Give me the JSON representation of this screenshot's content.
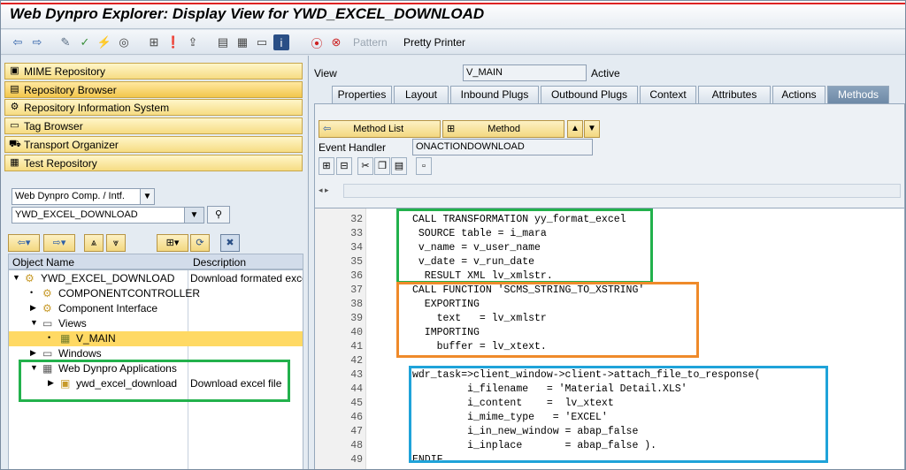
{
  "window": {
    "title": "Web Dynpro Explorer: Display View for YWD_EXCEL_DOWNLOAD"
  },
  "toolbar": {
    "pattern_label": "Pattern",
    "pretty_printer_label": "Pretty Printer"
  },
  "left_nav": {
    "items": [
      {
        "label": "MIME Repository",
        "icon": "mime-icon"
      },
      {
        "label": "Repository Browser",
        "icon": "browser-icon"
      },
      {
        "label": "Repository Information System",
        "icon": "info-system-icon"
      },
      {
        "label": "Tag Browser",
        "icon": "tag-icon"
      },
      {
        "label": "Transport Organizer",
        "icon": "truck-icon"
      },
      {
        "label": "Test Repository",
        "icon": "test-icon"
      }
    ],
    "object_type": "Web Dynpro Comp. / Intf.",
    "object_name": "YWD_EXCEL_DOWNLOAD"
  },
  "tree": {
    "col_object": "Object Name",
    "col_desc": "Description",
    "rows": [
      {
        "name": "YWD_EXCEL_DOWNLOAD",
        "desc": "Download formated exce"
      },
      {
        "name": "COMPONENTCONTROLLER",
        "desc": ""
      },
      {
        "name": "Component Interface",
        "desc": ""
      },
      {
        "name": "Views",
        "desc": ""
      },
      {
        "name": "V_MAIN",
        "desc": ""
      },
      {
        "name": "Windows",
        "desc": ""
      },
      {
        "name": "Web Dynpro Applications",
        "desc": ""
      },
      {
        "name": "ywd_excel_download",
        "desc": "Download excel file"
      }
    ]
  },
  "view": {
    "label": "View",
    "name": "V_MAIN",
    "status": "Active"
  },
  "tabs": [
    "Properties",
    "Layout",
    "Inbound Plugs",
    "Outbound Plugs",
    "Context",
    "Attributes",
    "Actions",
    "Methods"
  ],
  "method_bar": {
    "method_list_label": "Method List",
    "method_label": "Method",
    "event_handler_label": "Event Handler",
    "event_handler_value": "ONACTIONDOWNLOAD"
  },
  "code": [
    {
      "n": "32",
      "t": "CALL TRANSFORMATION yy_format_excel"
    },
    {
      "n": "33",
      "t": " SOURCE table = i_mara"
    },
    {
      "n": "34",
      "t": " v_name = v_user_name"
    },
    {
      "n": "35",
      "t": " v_date = v_run_date"
    },
    {
      "n": "36",
      "t": "  RESULT XML lv_xmlstr."
    },
    {
      "n": "37",
      "t": "CALL FUNCTION 'SCMS_STRING_TO_XSTRING'"
    },
    {
      "n": "38",
      "t": "  EXPORTING"
    },
    {
      "n": "39",
      "t": "    text   = lv_xmlstr"
    },
    {
      "n": "40",
      "t": "  IMPORTING"
    },
    {
      "n": "41",
      "t": "    buffer = lv_xtext."
    },
    {
      "n": "42",
      "t": ""
    },
    {
      "n": "43",
      "t": "wdr_task=>client_window->client->attach_file_to_response("
    },
    {
      "n": "44",
      "t": "         i_filename   = 'Material Detail.XLS'"
    },
    {
      "n": "45",
      "t": "         i_content    =  lv_xtext"
    },
    {
      "n": "46",
      "t": "         i_mime_type   = 'EXCEL'"
    },
    {
      "n": "47",
      "t": "         i_in_new_window = abap_false"
    },
    {
      "n": "48",
      "t": "         i_inplace       = abap_false )."
    },
    {
      "n": "49",
      "t": "ENDIF."
    }
  ],
  "colors": {
    "green": "#22b14c",
    "orange": "#ef8a2a",
    "blue": "#1fa3d9"
  }
}
